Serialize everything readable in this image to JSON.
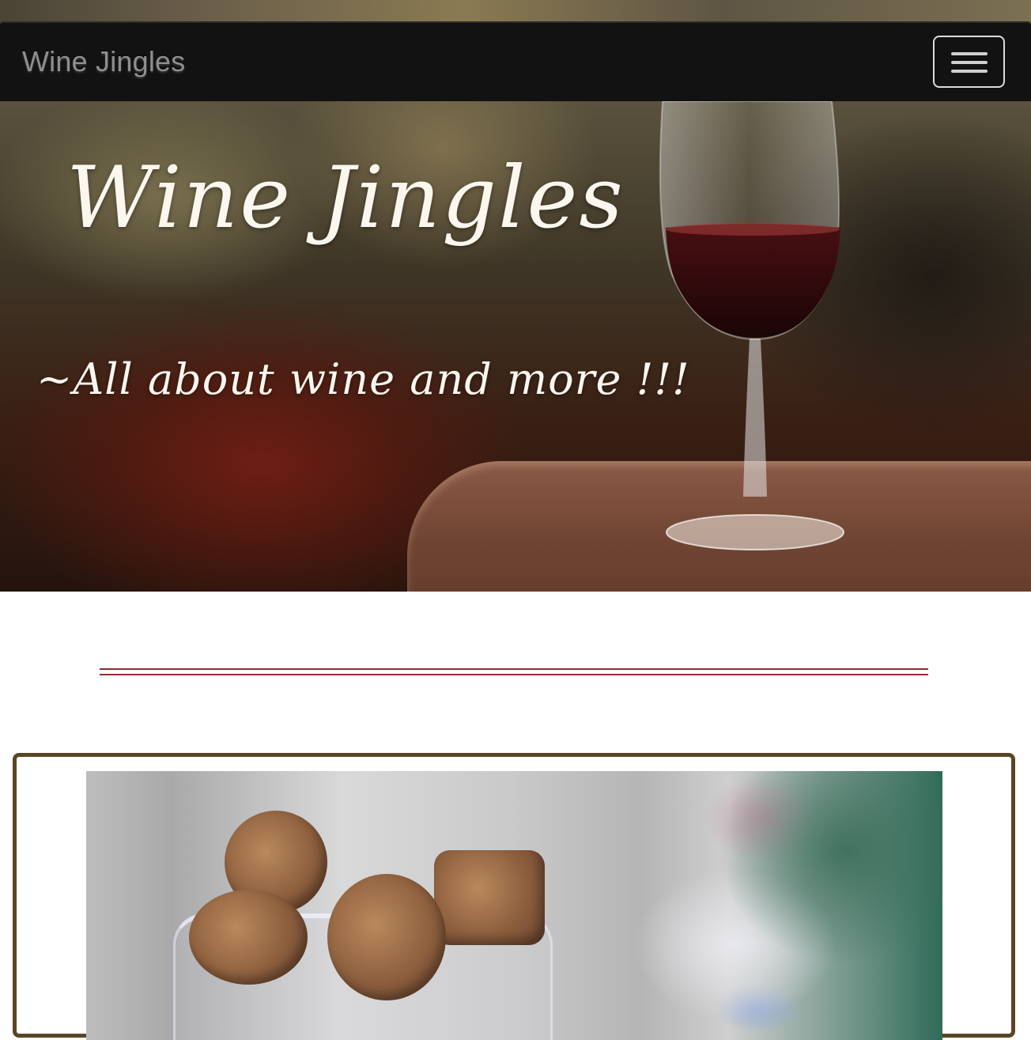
{
  "navbar": {
    "brand": "Wine Jingles",
    "toggler_icon": "hamburger-menu-icon"
  },
  "hero": {
    "title": "Wine Jingles",
    "tagline": "~All about wine and more !!!"
  },
  "colors": {
    "navbar_bg": "#121212",
    "divider": "#8c2d32",
    "card_border": "#5a4624"
  }
}
